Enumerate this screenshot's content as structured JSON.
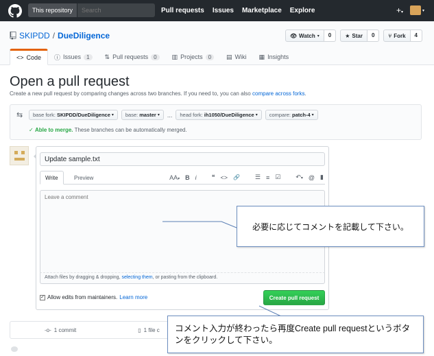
{
  "topbar": {
    "search_scope": "This repository",
    "search_placeholder": "Search",
    "nav": [
      "Pull requests",
      "Issues",
      "Marketplace",
      "Explore"
    ],
    "plus_label": "+",
    "plus_caret": "▾",
    "avatar_caret": "▾"
  },
  "repo": {
    "owner": "SKIPDD",
    "separator": "/",
    "name": "DueDiligence",
    "watch_label": "Watch",
    "watch_caret": "▾",
    "watch_count": "0",
    "star_label": "Star",
    "star_count": "0",
    "fork_label": "Fork",
    "fork_count": "4"
  },
  "tabs": [
    {
      "label": "Code",
      "icon": "code-icon",
      "counter": null,
      "selected": true
    },
    {
      "label": "Issues",
      "icon": "issue-icon",
      "counter": "1",
      "selected": false
    },
    {
      "label": "Pull requests",
      "icon": "pull-request-icon",
      "counter": "0",
      "selected": false
    },
    {
      "label": "Projects",
      "icon": "project-icon",
      "counter": "0",
      "selected": false
    },
    {
      "label": "Wiki",
      "icon": "book-icon",
      "counter": null,
      "selected": false
    },
    {
      "label": "Insights",
      "icon": "graph-icon",
      "counter": null,
      "selected": false
    }
  ],
  "page": {
    "title": "Open a pull request",
    "subtitle_text": "Create a new pull request by comparing changes across two branches. If you need to, you can also",
    "subtitle_link": "compare across forks",
    "subtitle_end": "."
  },
  "range": {
    "base_fork_prefix": "base fork:",
    "base_fork_value": "SKIPDD/DueDiligence",
    "base_prefix": "base:",
    "base_value": "master",
    "ellipsis": "...",
    "head_fork_prefix": "head fork:",
    "head_fork_value": "ih1050/DueDiligence",
    "compare_prefix": "compare:",
    "compare_value": "patch-4",
    "caret": "▾",
    "merge_check": "✓",
    "merge_ok": "Able to merge.",
    "merge_text": "These branches can be automatically merged."
  },
  "composer": {
    "title_value": "Update sample.txt",
    "tab_write": "Write",
    "tab_preview": "Preview",
    "comment_placeholder": "Leave a comment",
    "attach_text_1": "Attach files by dragging & dropping,",
    "attach_link": "selecting them",
    "attach_text_2": ", or pasting from the clipboard.",
    "allow_edits_check": "✓",
    "allow_edits_label": "Allow edits from maintainers.",
    "learn_more": "Learn more",
    "create_button": "Create pull request",
    "toolbar": {
      "header": "AA",
      "header_caret": "▾",
      "bold": "B",
      "italic": "i",
      "quote": "❝",
      "code": "<>",
      "link": "🔗",
      "unordered_list": "☰",
      "ordered_list": "≡",
      "task_list": "☑",
      "reply": "↶",
      "reply_caret": "▾",
      "mention": "@",
      "bookmark": "▮"
    }
  },
  "numbers": {
    "commits": "1 commit",
    "files": "1 file c"
  },
  "callouts": {
    "comment_hint": "必要に応じてコメントを記載して下さい。",
    "create_hint": "コメント入力が終わったら再度Create pull requestというボタンをクリックして下さい。"
  }
}
